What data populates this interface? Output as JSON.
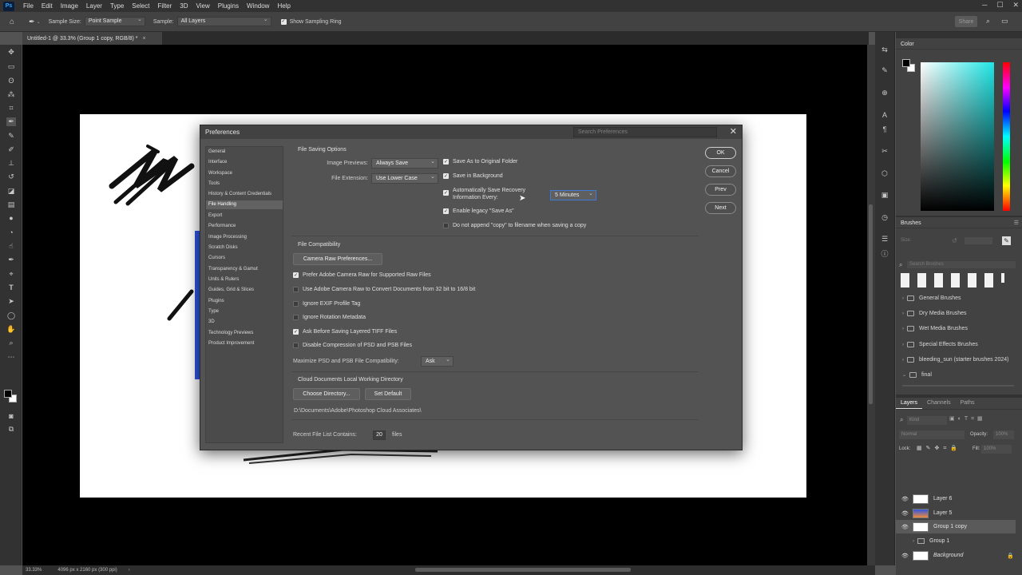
{
  "menubar": {
    "logo": "Ps",
    "items": [
      "File",
      "Edit",
      "Image",
      "Layer",
      "Type",
      "Select",
      "Filter",
      "3D",
      "View",
      "Plugins",
      "Window",
      "Help"
    ]
  },
  "options_bar": {
    "sample_size_label": "Sample Size:",
    "sample_size_value": "Point Sample",
    "sample_label": "Sample:",
    "sample_value": "All Layers",
    "show_ring_label": "Show Sampling Ring",
    "show_ring_checked": true,
    "share_label": "Share"
  },
  "document_tab": {
    "title": "Untitled-1 @ 33.3% (Group 1 copy, RGB/8) *"
  },
  "status_bar": {
    "zoom": "33.33%",
    "doc_info": "4096 px x 2160 px (300 ppi)"
  },
  "panels": {
    "color": {
      "title": "Color",
      "foreground": "#000000",
      "background": "#ffffff",
      "hue": "#1fe6e6"
    },
    "brushes": {
      "title": "Brushes",
      "size_label": "Size:",
      "search_placeholder": "Search Brushes",
      "folders": [
        "General Brushes",
        "Dry Media Brushes",
        "Wet Media Brushes",
        "Special Effects Brushes",
        "bleeding_sun (starter brushes 2024)",
        "final"
      ]
    },
    "layers": {
      "tabs": [
        "Layers",
        "Channels",
        "Paths"
      ],
      "kind_placeholder": "Kind",
      "blend_mode": "Normal",
      "opacity_label": "Opacity:",
      "opacity_value": "100%",
      "lock_label": "Lock:",
      "fill_label": "Fill:",
      "fill_value": "100%",
      "items": [
        {
          "name": "Layer 6",
          "visible": true,
          "selected": false
        },
        {
          "name": "Layer 5",
          "visible": true,
          "selected": false
        },
        {
          "name": "Group 1 copy",
          "visible": true,
          "selected": true
        },
        {
          "name": "Group 1",
          "visible": false,
          "selected": false
        },
        {
          "name": "Background",
          "visible": true,
          "selected": false
        }
      ]
    }
  },
  "dialog": {
    "title": "Preferences",
    "search_placeholder": "Search Preferences",
    "categories": [
      "General",
      "Interface",
      "Workspace",
      "Tools",
      "History & Content Credentials",
      "File Handling",
      "Export",
      "Performance",
      "Image Processing",
      "Scratch Disks",
      "Cursors",
      "Transparency & Gamut",
      "Units & Rulers",
      "Guides, Grid & Slices",
      "Plugins",
      "Type",
      "3D",
      "Technology Previews",
      "Product Improvement"
    ],
    "active_category": "File Handling",
    "buttons": {
      "ok": "OK",
      "cancel": "Cancel",
      "prev": "Prev",
      "next": "Next"
    },
    "file_saving": {
      "title": "File Saving Options",
      "image_previews_label": "Image Previews:",
      "image_previews_value": "Always Save",
      "file_extension_label": "File Extension:",
      "file_extension_value": "Use Lower Case",
      "save_as_original": {
        "label": "Save As to Original Folder",
        "checked": true
      },
      "save_background": {
        "label": "Save in Background",
        "checked": true
      },
      "auto_save_line1": "Automatically Save Recovery",
      "auto_save_line2": "Information Every:",
      "auto_save_checked": true,
      "auto_save_interval": "5 Minutes",
      "legacy_save_as": {
        "label": "Enable legacy \"Save As\"",
        "checked": true
      },
      "no_copy": {
        "label": "Do not append \"copy\" to filename when saving a copy",
        "checked": false
      }
    },
    "file_compat": {
      "title": "File Compatibility",
      "camera_raw_button": "Camera Raw Preferences...",
      "options": [
        {
          "label": "Prefer Adobe Camera Raw for Supported Raw Files",
          "checked": true
        },
        {
          "label": "Use Adobe Camera Raw to Convert Documents from 32 bit to 16/8 bit",
          "checked": false
        },
        {
          "label": "Ignore EXIF Profile Tag",
          "checked": false
        },
        {
          "label": "Ignore Rotation Metadata",
          "checked": false
        },
        {
          "label": "Ask Before Saving Layered TIFF Files",
          "checked": true
        },
        {
          "label": "Disable Compression of PSD and PSB Files",
          "checked": false
        }
      ],
      "maximize_label": "Maximize PSD and PSB File Compatibility:",
      "maximize_value": "Ask"
    },
    "cloud": {
      "title": "Cloud Documents Local Working Directory",
      "choose_button": "Choose Directory...",
      "default_button": "Set Default",
      "path": "D:\\Documents\\Adobe\\Photoshop Cloud Associates\\"
    },
    "recent": {
      "label": "Recent File List Contains:",
      "value": "20",
      "unit": "files"
    }
  }
}
